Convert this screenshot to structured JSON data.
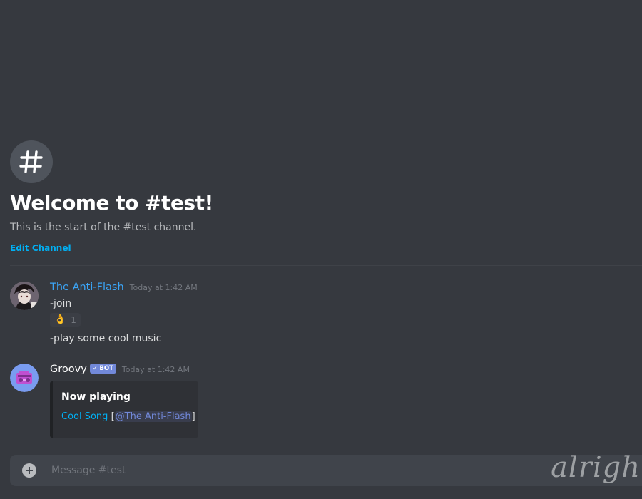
{
  "channel": {
    "welcome_title": "Welcome to #test!",
    "welcome_subtitle": "This is the start of the #test channel.",
    "edit_label": "Edit Channel",
    "icon": "hash-icon"
  },
  "messages": [
    {
      "username": "The Anti-Flash",
      "timestamp": "Today at 1:42 AM",
      "lines": [
        "-join",
        "-play some cool music"
      ],
      "reaction": {
        "emoji": "👌",
        "count": "1"
      }
    },
    {
      "username": "Groovy",
      "bot_tag": "BOT",
      "bot_check": "✓",
      "timestamp": "Today at 1:42 AM",
      "embed": {
        "title": "Now playing",
        "song": "Cool Song",
        "bracket_open": "[",
        "mention": "@The Anti-Flash",
        "bracket_close": "]"
      }
    }
  ],
  "input": {
    "placeholder": "Message #test"
  },
  "watermark": "alrigh",
  "colors": {
    "background": "#36393f",
    "link": "#00b0f4",
    "username_blue": "#3ba5f7",
    "bot_tag": "#7289da",
    "embed_bg": "#2f3136",
    "input_bg": "#40444b"
  }
}
